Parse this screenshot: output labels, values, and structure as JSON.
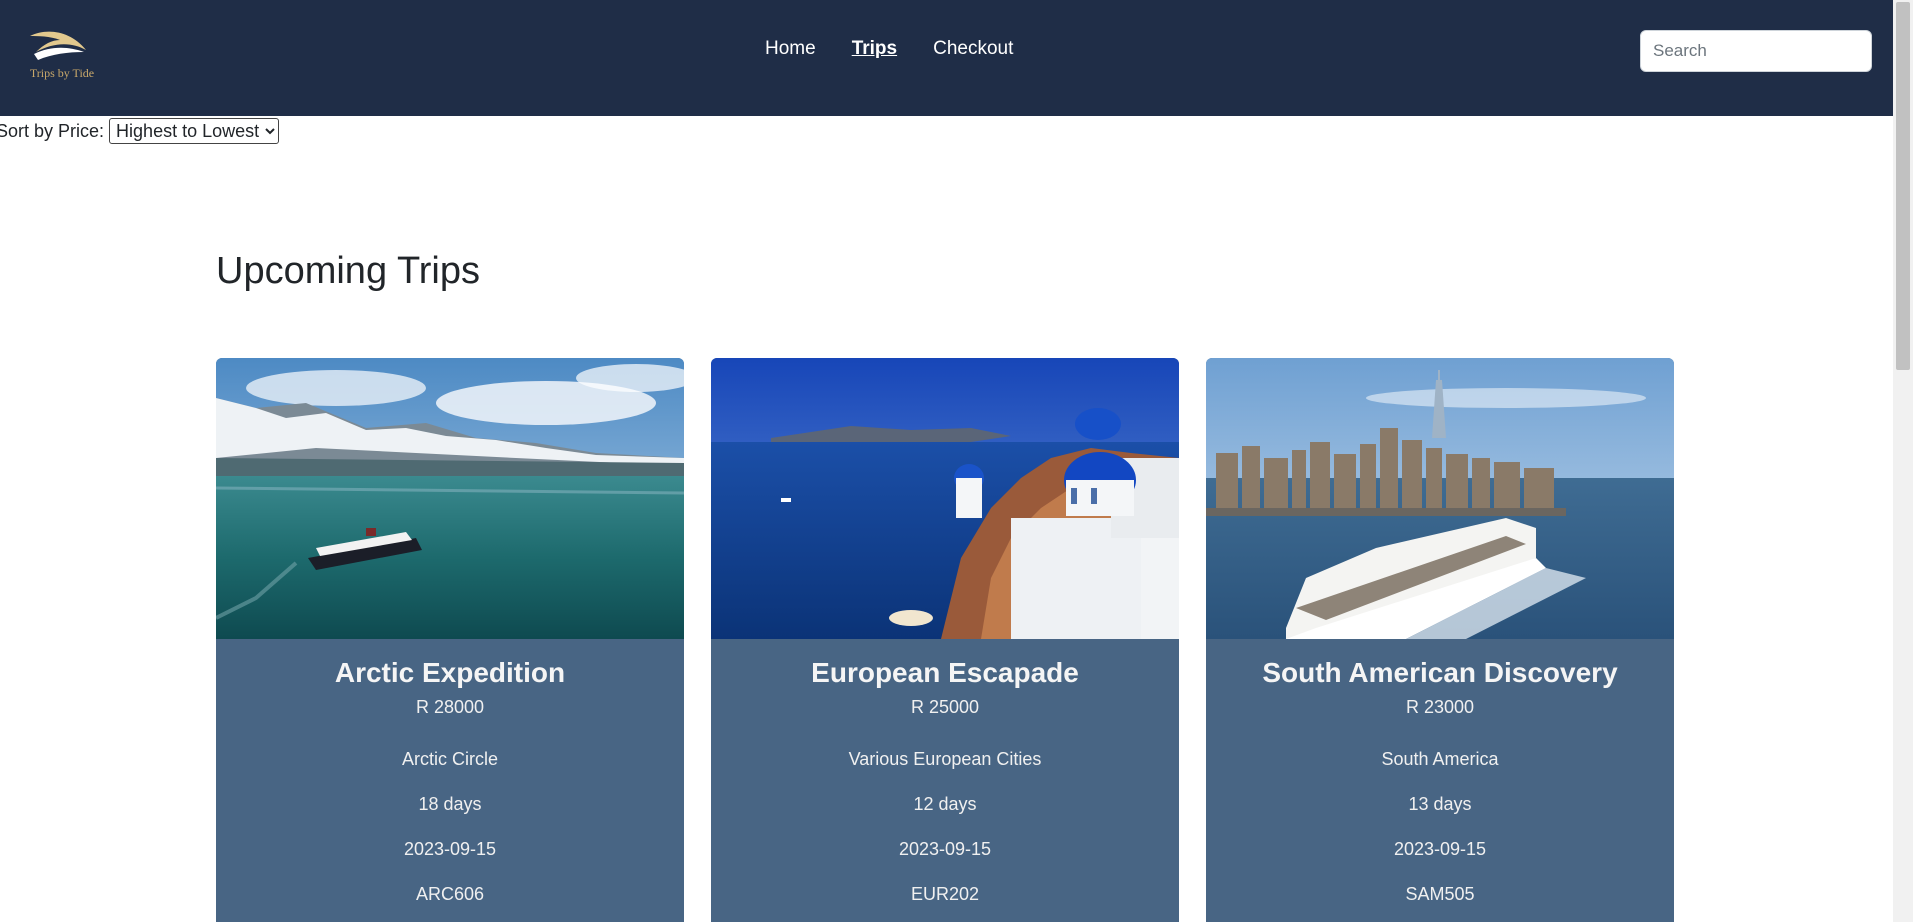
{
  "brand": {
    "name": "Trips by Tide",
    "gold": "#c9a86a"
  },
  "nav": {
    "items": [
      {
        "label": "Home",
        "active": false
      },
      {
        "label": "Trips",
        "active": true
      },
      {
        "label": "Checkout",
        "active": false
      }
    ],
    "search_placeholder": "Search",
    "background": "#1f2d47"
  },
  "sort": {
    "label": "Sort by Price:",
    "selected": "Highest to Lowest"
  },
  "section": {
    "title": "Upcoming Trips"
  },
  "cards": [
    {
      "title": "Arctic Expedition",
      "price": "R 28000",
      "destination": "Arctic Circle",
      "duration": "18 days",
      "date": "2023-09-15",
      "code": "ARC606",
      "image_icon": "glacier-cruise-photo"
    },
    {
      "title": "European Escapade",
      "price": "R 25000",
      "destination": "Various European Cities",
      "duration": "12 days",
      "date": "2023-09-15",
      "code": "EUR202",
      "image_icon": "santorini-photo"
    },
    {
      "title": "South American Discovery",
      "price": "R 23000",
      "destination": "South America",
      "duration": "13 days",
      "date": "2023-09-15",
      "code": "SAM505",
      "image_icon": "city-cruise-ship-photo"
    }
  ],
  "colors": {
    "card_background": "#486584"
  }
}
